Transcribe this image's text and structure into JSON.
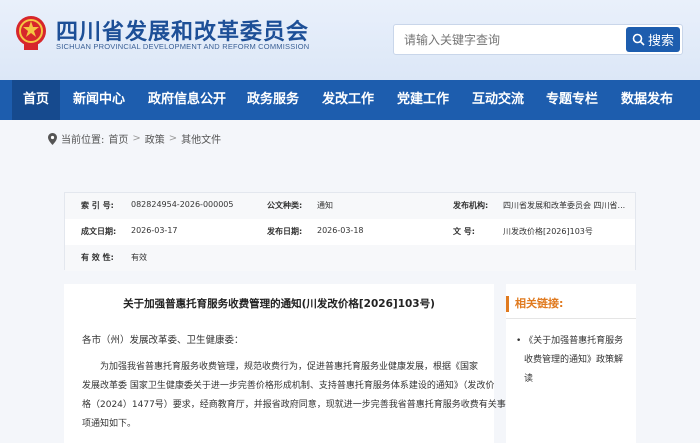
{
  "header": {
    "title": "四川省发展和改革委员会",
    "subtitle": "SICHUAN PROVINCIAL DEVELOPMENT AND REFORM COMMISSION",
    "search_placeholder": "请输入关键字查询",
    "search_button": "搜索"
  },
  "nav": {
    "items": [
      "首页",
      "新闻中心",
      "政府信息公开",
      "政务服务",
      "发改工作",
      "党建工作",
      "互动交流",
      "专题专栏",
      "数据发布"
    ],
    "active_index": 0
  },
  "breadcrumb": {
    "prefix": "当前位置:",
    "items": [
      "首页",
      "政策",
      "其他文件"
    ],
    "separator": ">"
  },
  "meta": {
    "index_label": "索 引 号:",
    "index_value": "082824954-2026-000005",
    "type_label": "公文种类:",
    "type_value": "通知",
    "agency_label": "发布机构:",
    "agency_value": "四川省发展和改革委员会  四川省...",
    "created_label": "成文日期:",
    "created_value": "2026-03-17",
    "published_label": "发布日期:",
    "published_value": "2026-03-18",
    "docno_label": "文      号:",
    "docno_value": "川发改价格[2026]103号",
    "valid_label": "有 效 性:",
    "valid_value": "有效"
  },
  "article": {
    "title": "关于加强普惠托育服务收费管理的通知(川发改价格[2026]103号)",
    "greeting": "各市（州）发展改革委、卫生健康委：",
    "body_lines": [
      "为加强我省普惠托育服务收费管理，规范收费行为，促进普惠托育服务业健康发展，根据《国家",
      "发展改革委 国家卫生健康委关于进一步完善价格形成机制、支持普惠托育服务体系建设的通知》（发改价",
      "格（2024）1477号）要求，经商教育厅，并报省政府同意，现就进一步完善我省普惠托育服务收费有关事",
      "项通知如下。"
    ]
  },
  "related": {
    "heading": "相关链接:",
    "link_lines": [
      "• 《关于加强普惠托育服务",
      "收费管理的通知》政策解",
      "读"
    ]
  },
  "colors": {
    "brand_blue": "#1d5dae",
    "accent_orange": "#e07a1f"
  },
  "icons": {
    "emblem": "national-emblem-icon",
    "search": "search-icon",
    "location": "location-pin-icon"
  }
}
